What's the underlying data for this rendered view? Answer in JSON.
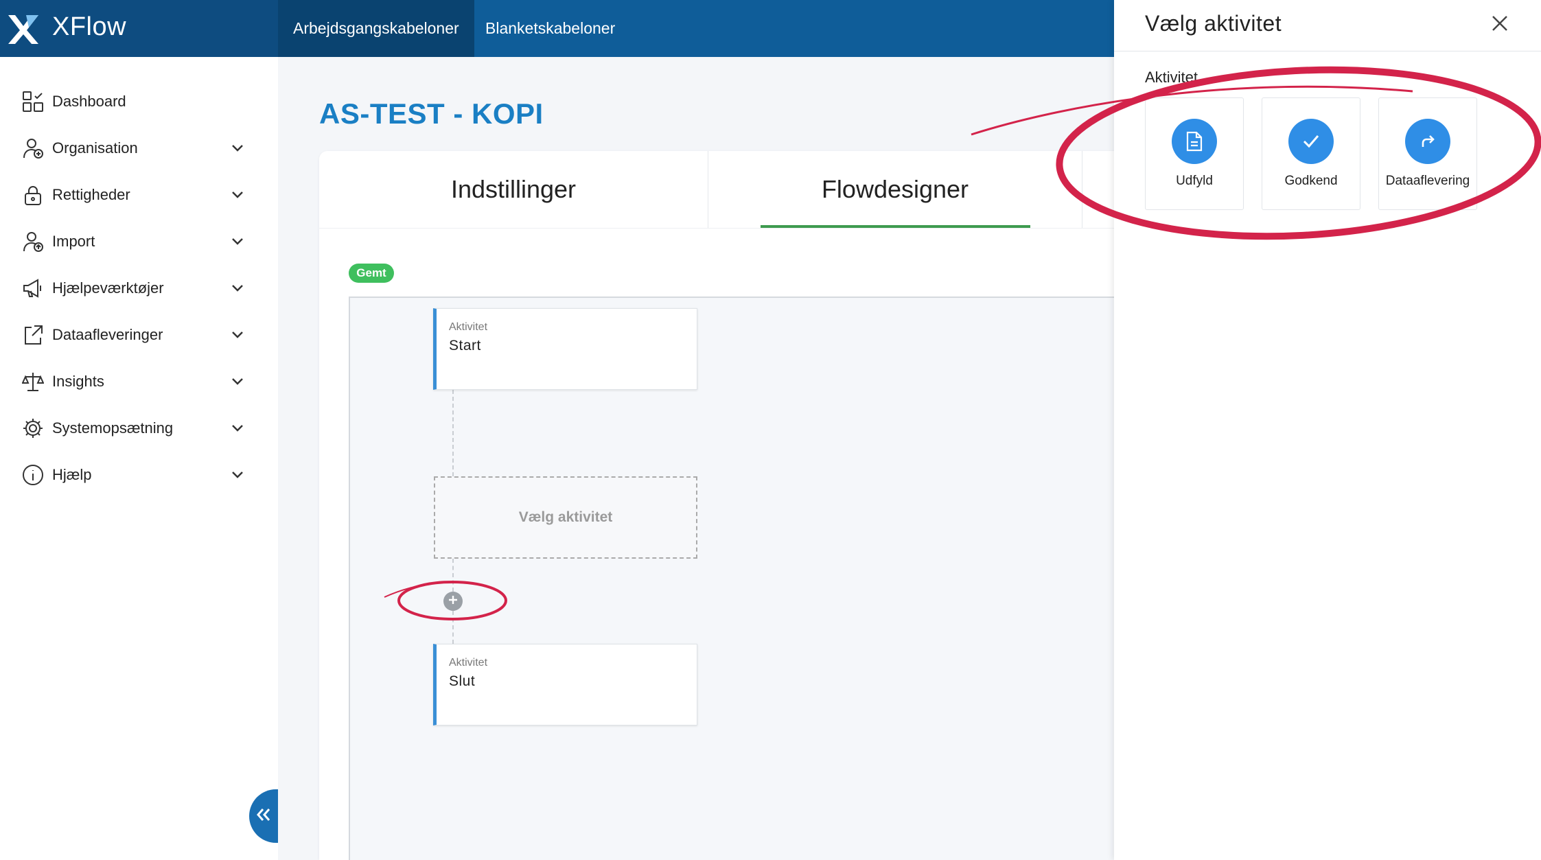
{
  "app": {
    "name": "XFlow"
  },
  "topnav": {
    "items": [
      {
        "label": "Arbejdsgangskabeloner",
        "active": true
      },
      {
        "label": "Blanketskabeloner",
        "active": false
      }
    ]
  },
  "sidebar": {
    "items": [
      {
        "label": "Dashboard",
        "icon": "dashboard-icon",
        "has_chevron": false
      },
      {
        "label": "Organisation",
        "icon": "organisation-icon",
        "has_chevron": true
      },
      {
        "label": "Rettigheder",
        "icon": "lock-icon",
        "has_chevron": true
      },
      {
        "label": "Import",
        "icon": "import-icon",
        "has_chevron": true
      },
      {
        "label": "Hjælpeværktøjer",
        "icon": "megaphone-icon",
        "has_chevron": true
      },
      {
        "label": "Dataafleveringer",
        "icon": "export-icon",
        "has_chevron": true
      },
      {
        "label": "Insights",
        "icon": "scales-icon",
        "has_chevron": true
      },
      {
        "label": "Systemopsætning",
        "icon": "gear-icon",
        "has_chevron": true
      },
      {
        "label": "Hjælp",
        "icon": "info-icon",
        "has_chevron": true
      }
    ]
  },
  "main": {
    "title": "AS-TEST - KOPI",
    "tabs": [
      {
        "label": "Indstillinger",
        "active": false
      },
      {
        "label": "Flowdesigner",
        "active": true
      }
    ],
    "status_badge": "Gemt"
  },
  "flow": {
    "start": {
      "type": "Aktivitet",
      "name": "Start"
    },
    "placeholder": "Vælg aktivitet",
    "end": {
      "type": "Aktivitet",
      "name": "Slut"
    }
  },
  "panel": {
    "title": "Vælg aktivitet",
    "section_label": "Aktivitet",
    "activities": [
      {
        "label": "Udfyld",
        "icon": "document-icon"
      },
      {
        "label": "Godkend",
        "icon": "checkmark-icon"
      },
      {
        "label": "Dataaflevering",
        "icon": "forward-arrow-icon"
      }
    ]
  },
  "colors": {
    "topbar": "#0f5d99",
    "accent_blue": "#1a7fc4",
    "tab_underline": "#3e9b4f",
    "badge_green": "#3fbf5e",
    "annotation_red": "#d3234a"
  }
}
